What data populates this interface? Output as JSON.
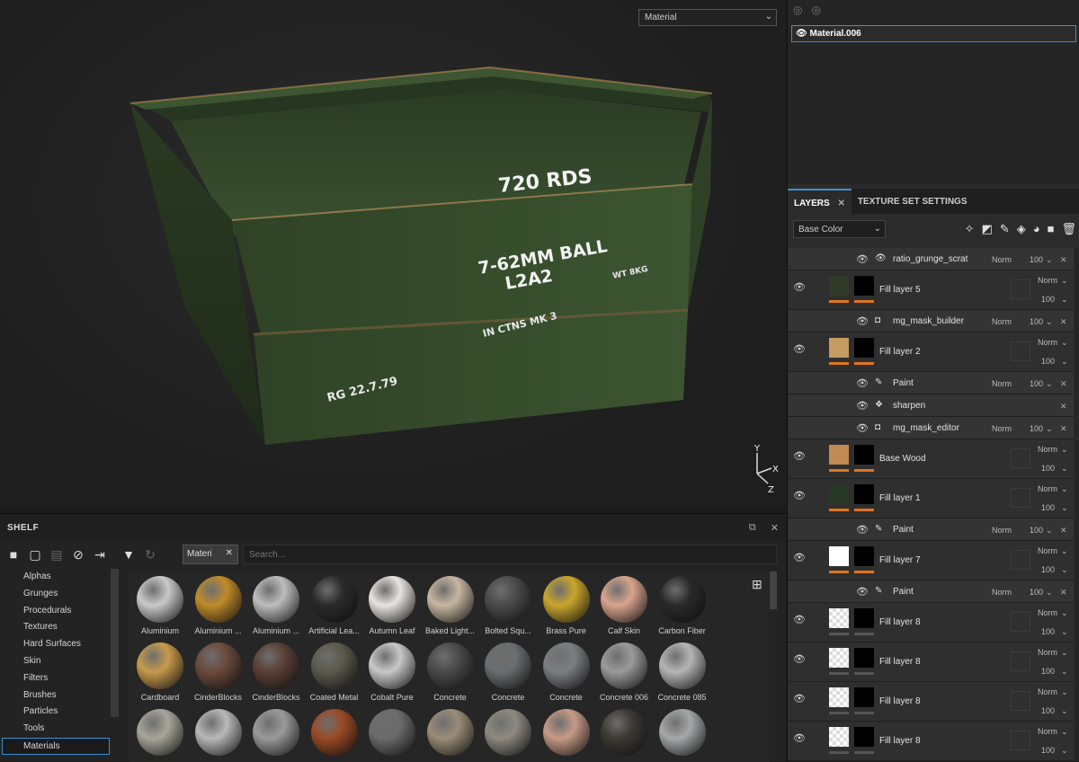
{
  "viewport": {
    "display_channel": "Material",
    "crate_texts": [
      "720 RDS",
      "7-62MM BALL",
      "L2A2",
      "WT 8KG",
      "IN CTNS MK 3",
      "RG 22.7.79"
    ],
    "axes": {
      "y": "Y",
      "x": "X",
      "z": "Z"
    }
  },
  "shelf": {
    "title": "SHELF",
    "filter_chip": "Materi",
    "search_placeholder": "Search...",
    "categories": [
      "Alphas",
      "Grunges",
      "Procedurals",
      "Textures",
      "Hard Surfaces",
      "Skin",
      "Filters",
      "Brushes",
      "Particles",
      "Tools",
      "Materials"
    ],
    "active_category": "Materials",
    "materials": [
      {
        "label": "Aluminium",
        "color": "#c9c9c9"
      },
      {
        "label": "Aluminium ...",
        "color": "#c08a2a"
      },
      {
        "label": "Aluminium ...",
        "color": "#bdbdbd"
      },
      {
        "label": "Artificial Lea...",
        "color": "#2b2b2b"
      },
      {
        "label": "Autumn Leaf",
        "color": "#e8e4df"
      },
      {
        "label": "Baked Light...",
        "color": "#c7b6a0"
      },
      {
        "label": "Bolted Squ...",
        "color": "#4a4a4a"
      },
      {
        "label": "Brass Pure",
        "color": "#c9a52c"
      },
      {
        "label": "Calf Skin",
        "color": "#d9a48d"
      },
      {
        "label": "Carbon Fiber",
        "color": "#2a2a2a"
      },
      {
        "label": "Cardboard",
        "color": "#c79a4d"
      },
      {
        "label": "CinderBlocks",
        "color": "#6b4a3c"
      },
      {
        "label": "CinderBlocks",
        "color": "#5b4035"
      },
      {
        "label": "Coated Metal",
        "color": "#5b5a4c"
      },
      {
        "label": "Cobalt Pure",
        "color": "#c8c8c8"
      },
      {
        "label": "Concrete",
        "color": "#4a4a4a"
      },
      {
        "label": "Concrete",
        "color": "#6a6e6e"
      },
      {
        "label": "Concrete",
        "color": "#7b7f80"
      },
      {
        "label": "Concrete 006",
        "color": "#9a9a9a"
      },
      {
        "label": "Concrete 085",
        "color": "#b5b5b5"
      },
      {
        "label": "",
        "color": "#a9a59a"
      },
      {
        "label": "",
        "color": "#b8b8b8"
      },
      {
        "label": "",
        "color": "#9a9a9a"
      },
      {
        "label": "",
        "color": "#9a4a25"
      },
      {
        "label": "",
        "color": "#6b6b6b"
      },
      {
        "label": "",
        "color": "#9a8d78"
      },
      {
        "label": "",
        "color": "#8f8a80"
      },
      {
        "label": "",
        "color": "#c79a86"
      },
      {
        "label": "",
        "color": "#3c3a33"
      },
      {
        "label": "",
        "color": "#a5a8a8"
      }
    ]
  },
  "texture_set": {
    "item": "Material.006"
  },
  "layers_panel": {
    "tabs": [
      "LAYERS",
      "TEXTURE SET SETTINGS"
    ],
    "channel": "Base Color",
    "rows": [
      {
        "kind": "sub",
        "name": "ratio_grunge_scrat",
        "icon": "eye",
        "blend": "Norm",
        "opacity": "100"
      },
      {
        "kind": "main",
        "name": "Fill layer 5",
        "thumb": "#2f3a28",
        "bar": "#e0761f",
        "blend": "Norm",
        "opacity": "100"
      },
      {
        "kind": "sub",
        "name": "mg_mask_builder",
        "icon": "mask",
        "blend": "Norm",
        "opacity": "100"
      },
      {
        "kind": "main",
        "name": "Fill layer 2",
        "thumb": "#c69b62",
        "bar": "#e0761f",
        "blend": "Norm",
        "opacity": "100"
      },
      {
        "kind": "sub",
        "name": "Paint",
        "icon": "brush",
        "blend": "Norm",
        "opacity": "100"
      },
      {
        "kind": "sub",
        "name": "sharpen",
        "icon": "filter",
        "blend": "",
        "opacity": ""
      },
      {
        "kind": "sub",
        "name": "mg_mask_editor",
        "icon": "mask",
        "blend": "Norm",
        "opacity": "100"
      },
      {
        "kind": "main",
        "name": "Base Wood",
        "thumb": "#c08a52",
        "bar": "#e0761f",
        "blend": "Norm",
        "opacity": "100"
      },
      {
        "kind": "main",
        "name": "Fill layer 1",
        "thumb": "#283826",
        "bar": "#e0761f",
        "blend": "Norm",
        "opacity": "100"
      },
      {
        "kind": "sub",
        "name": "Paint",
        "icon": "brush",
        "blend": "Norm",
        "opacity": "100"
      },
      {
        "kind": "main",
        "name": "Fill layer 7",
        "thumb": "#ffffff",
        "bar": "#e0761f",
        "blend": "Norm",
        "opacity": "100"
      },
      {
        "kind": "sub",
        "name": "Paint",
        "icon": "brush",
        "blend": "Norm",
        "opacity": "100"
      },
      {
        "kind": "main",
        "name": "Fill layer 8",
        "thumb": "checker",
        "bar": "#555555",
        "blend": "Norm",
        "opacity": "100"
      },
      {
        "kind": "main",
        "name": "Fill layer 8",
        "thumb": "checker",
        "bar": "#555555",
        "blend": "Norm",
        "opacity": "100"
      },
      {
        "kind": "main",
        "name": "Fill layer 8",
        "thumb": "checker",
        "bar": "#555555",
        "blend": "Norm",
        "opacity": "100"
      },
      {
        "kind": "main",
        "name": "Fill layer 8",
        "thumb": "checker",
        "bar": "#555555",
        "blend": "Norm",
        "opacity": "100"
      }
    ]
  }
}
